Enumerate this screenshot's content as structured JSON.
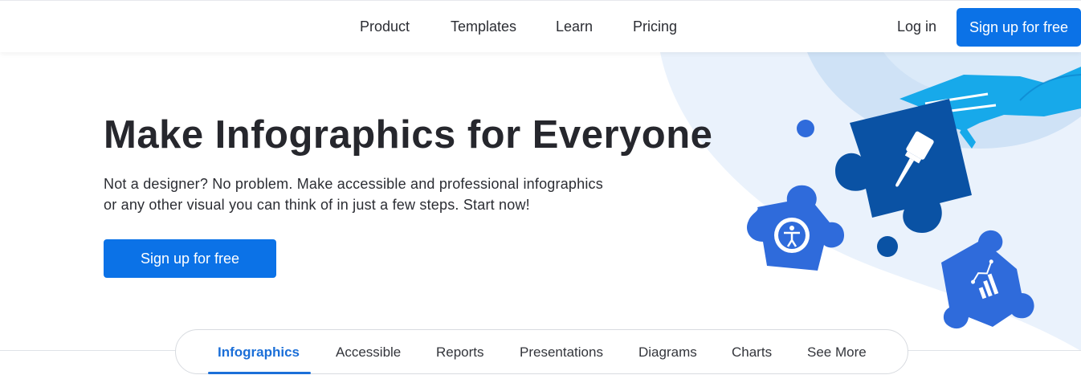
{
  "header": {
    "nav": [
      "Product",
      "Templates",
      "Learn",
      "Pricing"
    ],
    "login": "Log in",
    "signup": "Sign up for free"
  },
  "hero": {
    "title": "Make Infographics for Everyone",
    "subtitle_line1": "Not a designer? No problem. Make accessible and professional infographics",
    "subtitle_line2": "or any other visual you can think of in just a few steps. Start now!",
    "cta": "Sign up for free",
    "illustration_icons": [
      "paintbrush-icon",
      "accessibility-icon",
      "chart-icon"
    ]
  },
  "tabs": {
    "items": [
      "Infographics",
      "Accessible",
      "Reports",
      "Presentations",
      "Diagrams",
      "Charts",
      "See More"
    ],
    "active": "Infographics"
  },
  "colors": {
    "brand_blue": "#0b72e7",
    "puzzle_dark": "#0a52a4",
    "puzzle_mid": "#2f6bdb",
    "hand_cyan": "#1aa8e8",
    "bg_light": "#e8f1fb"
  }
}
